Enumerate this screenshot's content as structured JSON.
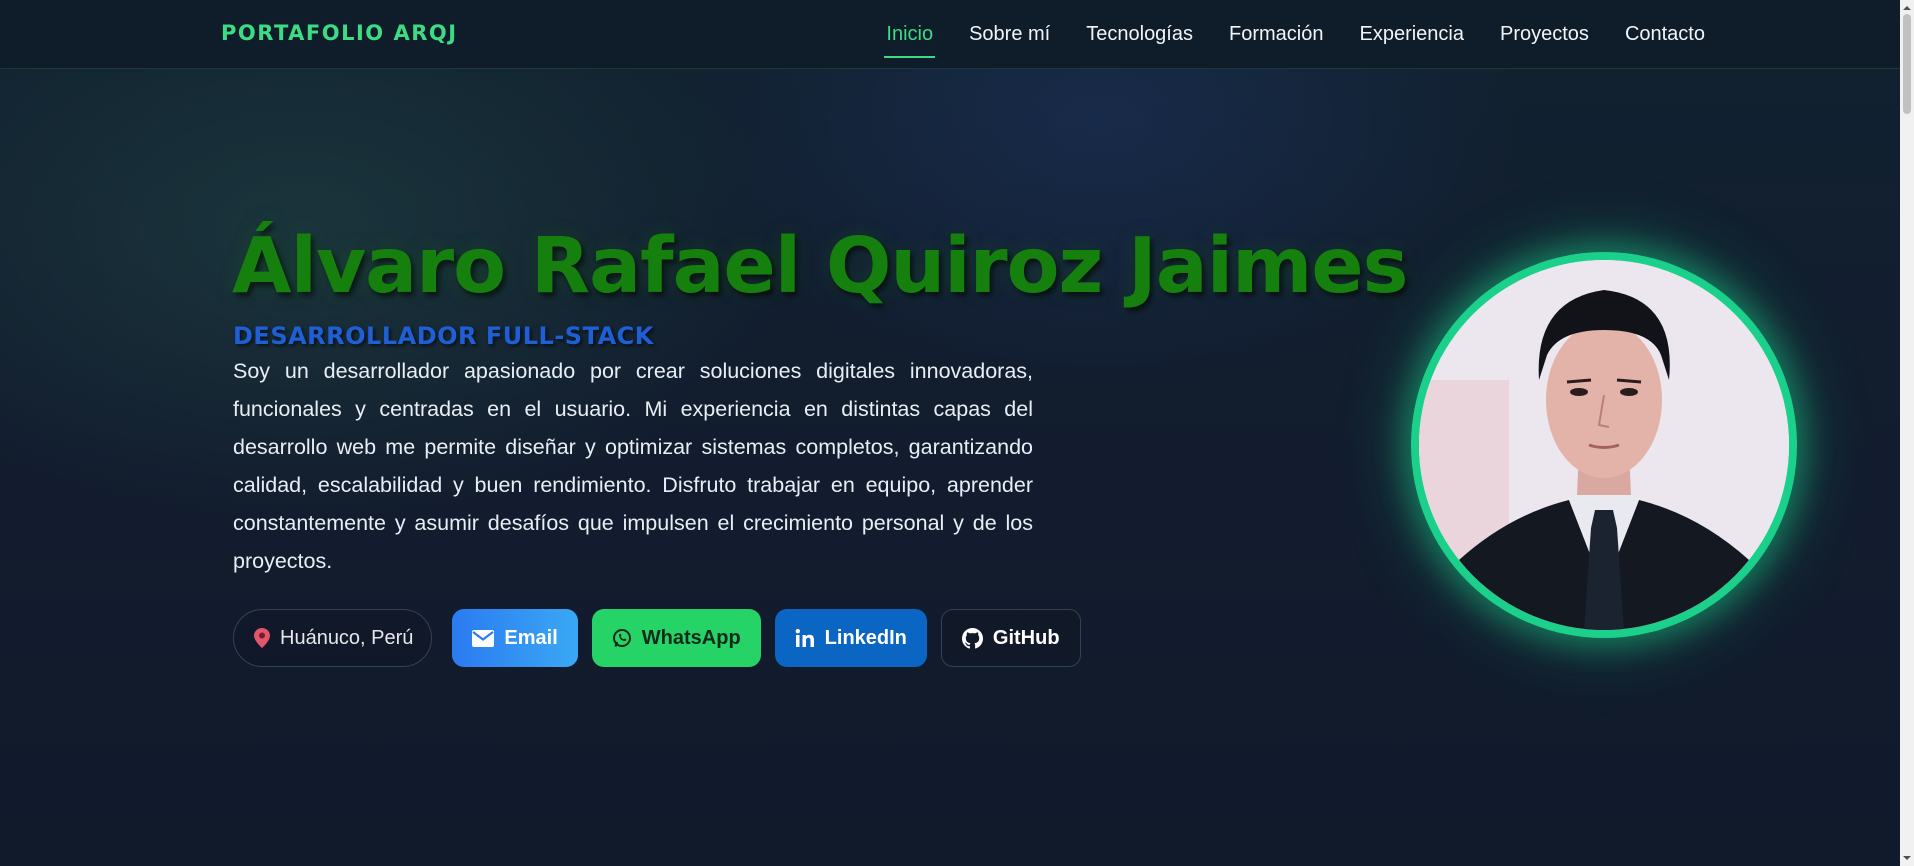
{
  "brand": "PORTAFOLIO ARQJ",
  "nav": {
    "items": [
      {
        "label": "Inicio",
        "active": true
      },
      {
        "label": "Sobre mí"
      },
      {
        "label": "Tecnologías"
      },
      {
        "label": "Formación"
      },
      {
        "label": "Experiencia"
      },
      {
        "label": "Proyectos"
      },
      {
        "label": "Contacto"
      }
    ]
  },
  "hero": {
    "name": "Álvaro Rafael Quiroz Jaimes",
    "role": "DESARROLLADOR FULL-STACK",
    "bio": "Soy un desarrollador apasionado por crear soluciones digitales innovadoras, funcionales y centradas en el usuario. Mi experiencia en distintas capas del desarrollo web me permite diseñar y optimizar sistemas completos, garantizando calidad, escalabilidad y buen rendimiento. Disfruto trabajar en equipo, aprender constantemente y asumir desafíos que impulsen el crecimiento personal y de los proyectos."
  },
  "contact": {
    "location": "Huánuco, Perú",
    "email": "Email",
    "whatsapp": "WhatsApp",
    "linkedin": "LinkedIn",
    "github": "GitHub"
  },
  "icons": {
    "location": "map-pin-icon",
    "email": "envelope-icon",
    "whatsapp": "whatsapp-icon",
    "linkedin": "linkedin-icon",
    "github": "github-icon"
  },
  "colors": {
    "accent": "#3ddc84",
    "name": "#16800f",
    "role": "#1f5fd6",
    "ring": "#1bd08a",
    "whatsapp": "#25d366",
    "linkedin": "#0a66c2"
  }
}
